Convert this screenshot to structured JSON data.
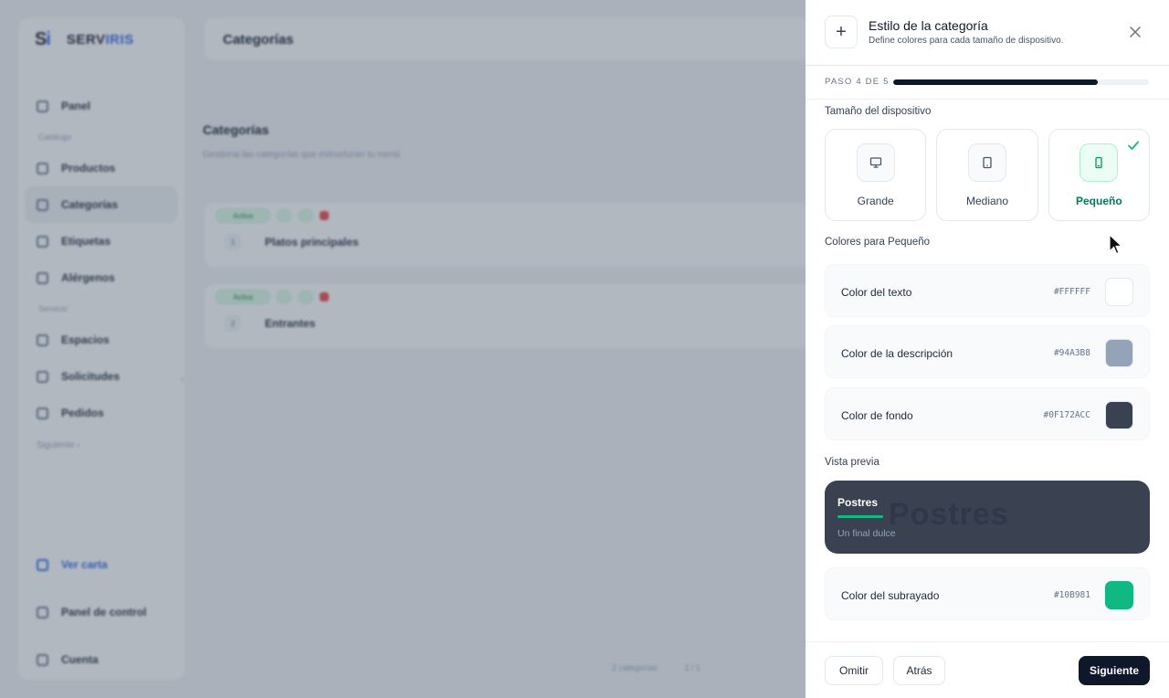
{
  "background": {
    "brand": {
      "mark": "S",
      "mark_accent": "i",
      "name": "SERV",
      "name_accent": "IRIS"
    },
    "topbar_title": "Categorías",
    "sidebar": {
      "items_top": [
        {
          "label": "Panel",
          "icon": "grid-icon"
        }
      ],
      "section_catalog": "Catálogo",
      "items_catalog": [
        {
          "label": "Productos",
          "icon": "box-icon",
          "active": false
        },
        {
          "label": "Categorías",
          "icon": "grid-icon",
          "active": true
        },
        {
          "label": "Etiquetas",
          "icon": "tag-icon",
          "active": false
        },
        {
          "label": "Alérgenos",
          "icon": "chat-icon",
          "active": false
        }
      ],
      "section_service": "Servicio",
      "items_service": [
        {
          "label": "Espacios",
          "icon": "pin-icon"
        },
        {
          "label": "Solicitudes",
          "icon": "bell-icon"
        },
        {
          "label": "Pedidos",
          "icon": "receipt-icon"
        }
      ],
      "more_label": "Siguiente ›",
      "bottom": [
        {
          "label": "Ver carta",
          "icon": "external-icon",
          "link": true
        },
        {
          "label": "Panel de control",
          "icon": "dashboard-icon",
          "link": false
        },
        {
          "label": "Cuenta",
          "icon": "user-icon",
          "link": false
        }
      ]
    },
    "page_title": "Categorías",
    "page_subtitle": "Gestiona las categorías que estructuran tu menú",
    "categories": [
      {
        "status": "Activa",
        "name": "Platos principales",
        "handle": "1"
      },
      {
        "status": "Activa",
        "name": "Entrantes",
        "handle": "2"
      }
    ],
    "pager": [
      "2 categorías",
      "1 / 1"
    ]
  },
  "drawer": {
    "title": "Estilo de la categoría",
    "subtitle": "Define colores para cada tamaño de dispositivo.",
    "step": {
      "label": "PASO 4 DE 5",
      "progress_fraction": 0.8
    },
    "device_section_label": "Tamaño del dispositivo",
    "devices": [
      {
        "label": "Grande",
        "icon": "monitor-icon",
        "selected": false
      },
      {
        "label": "Mediano",
        "icon": "tablet-icon",
        "selected": false
      },
      {
        "label": "Pequeño",
        "icon": "phone-icon",
        "selected": true
      }
    ],
    "colors_section_label": "Colores para Pequeño",
    "colors": [
      {
        "label": "Color del texto",
        "hex": "#FFFFFF",
        "swatch": "#FFFFFF"
      },
      {
        "label": "Color de la descripción",
        "hex": "#94A3B8",
        "swatch": "#94A3B8"
      },
      {
        "label": "Color de fondo",
        "hex": "#0F172ACC",
        "swatch": "#3a4150"
      }
    ],
    "preview_section_label": "Vista previa",
    "preview": {
      "title": "Postres",
      "description": "Un final dulce",
      "underline_color": "#10B981",
      "background_color": "#3a4150"
    },
    "underline_color_row": {
      "label": "Color del subrayado",
      "hex": "#10B981",
      "swatch": "#10B981"
    },
    "footer": {
      "skip": "Omitir",
      "back": "Atrás",
      "next": "Siguiente"
    }
  }
}
